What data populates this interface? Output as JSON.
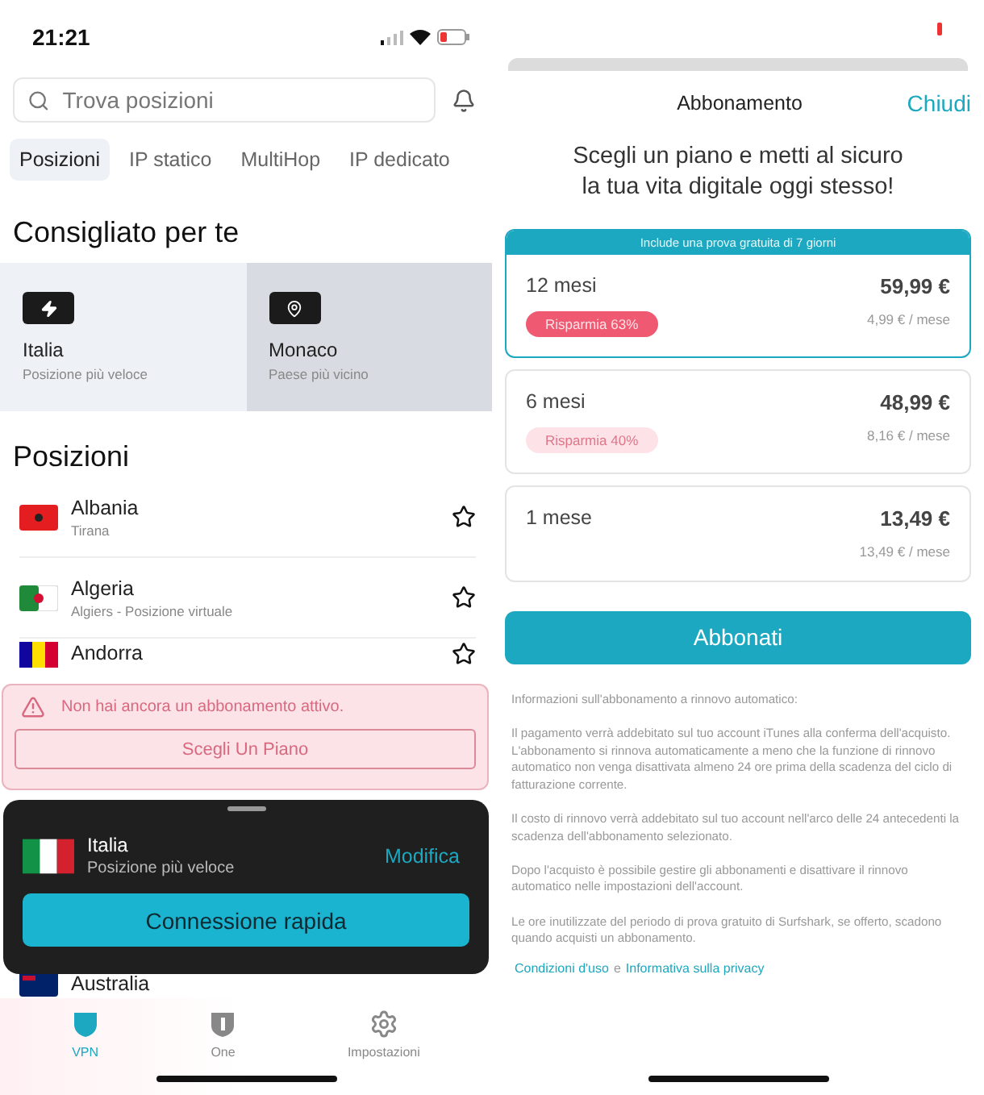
{
  "left_screen": {
    "status_bar": {
      "time": "21:21"
    },
    "search": {
      "placeholder": "Trova posizioni"
    },
    "tabs": [
      {
        "label": "Posizioni",
        "selected": true
      },
      {
        "label": "IP statico",
        "selected": false
      },
      {
        "label": "MultiHop",
        "selected": false
      },
      {
        "label": "IP dedicato",
        "selected": false
      }
    ],
    "recommended": {
      "title": "Consigliato per te",
      "cards": [
        {
          "kind": "fastest",
          "name": "Italia",
          "subtitle": "Posizione più veloce",
          "selected": false
        },
        {
          "kind": "nearest",
          "name": "Monaco",
          "subtitle": "Paese più vicino",
          "selected": true
        }
      ]
    },
    "locations": {
      "title": "Posizioni",
      "rows": [
        {
          "kind": "albania",
          "name": "Albania",
          "subtitle": "Tirana"
        },
        {
          "kind": "algeria",
          "name": "Algeria",
          "subtitle": "Algiers - Posizione virtuale"
        },
        {
          "kind": "andorra",
          "name": "Andorra"
        }
      ],
      "partial_row": {
        "kind": "australia",
        "name": "Australia"
      }
    },
    "alert": {
      "message": "Non hai ancora un abbonamento attivo.",
      "button": "Scegli Un Piano"
    },
    "connect_sheet": {
      "name": "Italia",
      "subtitle": "Posizione più veloce",
      "edit": "Modifica",
      "button": "Connessione rapida"
    },
    "tab_bar": [
      {
        "kind": "vpn",
        "label": "VPN",
        "selected": true
      },
      {
        "kind": "one",
        "label": "One",
        "selected": false
      },
      {
        "kind": "settings",
        "label": "Impostazioni",
        "selected": false
      }
    ]
  },
  "right_screen": {
    "header": {
      "title": "Abbonamento",
      "close": "Chiudi"
    },
    "headline": "Scegli un piano e metti al sicuro la tua vita digitale oggi stesso!",
    "plans": [
      {
        "duration": "12 mesi",
        "price": "59,99 €",
        "monthly": "4,99 € / mese",
        "badge": "Risparmia 63%",
        "banner": "Include una prova gratuita di 7 giorni",
        "selected": true
      },
      {
        "duration": "6 mesi",
        "price": "48,99 €",
        "monthly": "8,16 € / mese",
        "badge": "Risparmia 40%",
        "selected": false
      },
      {
        "duration": "1 mese",
        "price": "13,49 €",
        "monthly": "13,49 € / mese",
        "selected": false
      }
    ],
    "subscribe_button": "Abbonati",
    "info_paragraphs": [
      "Informazioni sull'abbonamento a rinnovo automatico:",
      "Il pagamento verrà addebitato sul tuo account iTunes alla conferma dell'acquisto. L'abbonamento si rinnova automaticamente a meno che la funzione di rinnovo automatico non venga disattivata almeno 24 ore prima della scadenza del ciclo di fatturazione corrente.",
      "Il costo di rinnovo verrà addebitato sul tuo account nell'arco delle 24 antecedenti la scadenza dell'abbonamento selezionato.",
      "Dopo l'acquisto è possibile gestire gli abbonamenti e disattivare il rinnovo automatico nelle impostazioni dell'account.",
      "Le ore inutilizzate del periodo di prova gratuito di Surfshark, se offerto, scadono quando acquisti un abbonamento."
    ],
    "links": {
      "terms": "Condizioni d'uso",
      "joiner": "e",
      "privacy": "Informativa sulla privacy"
    }
  }
}
